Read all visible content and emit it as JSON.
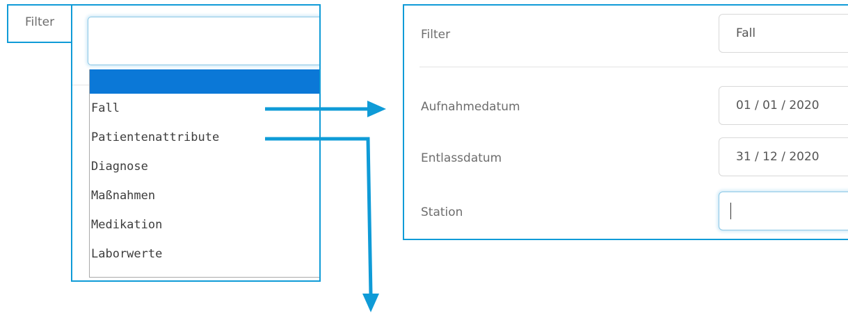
{
  "left": {
    "filter_label": "Filter",
    "options": [
      "",
      "Fall",
      "Patientenattribute",
      "Diagnose",
      "Maßnahmen",
      "Medikation",
      "Laborwerte"
    ]
  },
  "right": {
    "filter_label": "Filter",
    "filter_value": "Fall",
    "fields": [
      {
        "label": "Aufnahmedatum",
        "value": "01 / 01 / 2020"
      },
      {
        "label": "Entlassdatum",
        "value": "31 / 12 / 2020"
      },
      {
        "label": "Station",
        "value": ""
      }
    ]
  },
  "colors": {
    "accent_blue": "#0f9bd7",
    "selected_option": "#0b78d7",
    "focus_glow": "#cfe9f7"
  },
  "icons": [
    "arrow-right-icon",
    "arrow-down-icon"
  ]
}
